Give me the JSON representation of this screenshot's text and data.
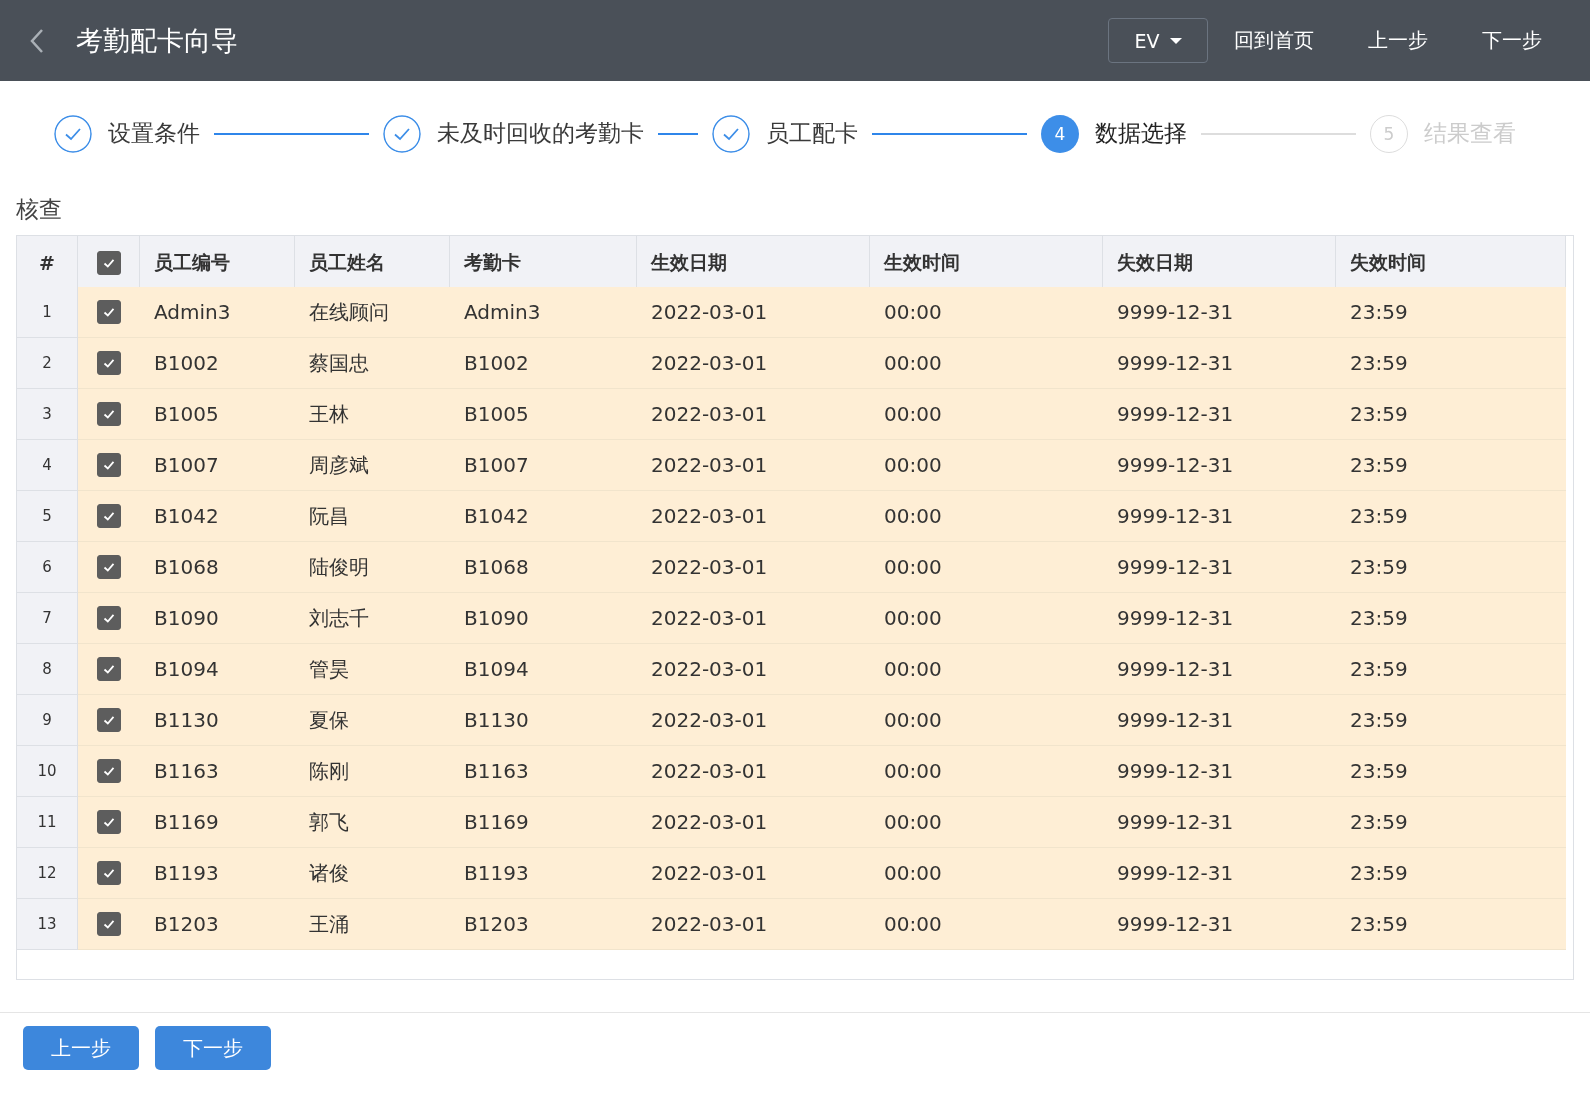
{
  "header": {
    "title": "考勤配卡向导",
    "lang_select": "EV",
    "links": [
      "回到首页",
      "上一步",
      "下一步"
    ]
  },
  "steps": [
    {
      "label": "设置条件",
      "completed": true,
      "current": false
    },
    {
      "label": "未及时回收的考勤卡",
      "completed": true,
      "current": false
    },
    {
      "label": "员工配卡",
      "completed": true,
      "current": false
    },
    {
      "number": "4",
      "label": "数据选择",
      "completed": false,
      "current": true
    },
    {
      "number": "5",
      "label": "结果查看",
      "completed": false,
      "current": false
    }
  ],
  "section_title": "核查",
  "table": {
    "columns": [
      "#",
      "员工编号",
      "员工姓名",
      "考勤卡",
      "生效日期",
      "生效时间",
      "失效日期",
      "失效时间"
    ],
    "all_checked": true,
    "rows": [
      {
        "checked": true,
        "cells": [
          "1",
          "Admin3",
          "在线顾问",
          "Admin3",
          "2022-03-01",
          "00:00",
          "9999-12-31",
          "23:59"
        ]
      },
      {
        "checked": true,
        "cells": [
          "2",
          "B1002",
          "蔡国忠",
          "B1002",
          "2022-03-01",
          "00:00",
          "9999-12-31",
          "23:59"
        ]
      },
      {
        "checked": true,
        "cells": [
          "3",
          "B1005",
          "王林",
          "B1005",
          "2022-03-01",
          "00:00",
          "9999-12-31",
          "23:59"
        ]
      },
      {
        "checked": true,
        "cells": [
          "4",
          "B1007",
          "周彦斌",
          "B1007",
          "2022-03-01",
          "00:00",
          "9999-12-31",
          "23:59"
        ]
      },
      {
        "checked": true,
        "cells": [
          "5",
          "B1042",
          "阮昌",
          "B1042",
          "2022-03-01",
          "00:00",
          "9999-12-31",
          "23:59"
        ]
      },
      {
        "checked": true,
        "cells": [
          "6",
          "B1068",
          "陆俊明",
          "B1068",
          "2022-03-01",
          "00:00",
          "9999-12-31",
          "23:59"
        ]
      },
      {
        "checked": true,
        "cells": [
          "7",
          "B1090",
          "刘志千",
          "B1090",
          "2022-03-01",
          "00:00",
          "9999-12-31",
          "23:59"
        ]
      },
      {
        "checked": true,
        "cells": [
          "8",
          "B1094",
          "管昊",
          "B1094",
          "2022-03-01",
          "00:00",
          "9999-12-31",
          "23:59"
        ]
      },
      {
        "checked": true,
        "cells": [
          "9",
          "B1130",
          "夏保",
          "B1130",
          "2022-03-01",
          "00:00",
          "9999-12-31",
          "23:59"
        ]
      },
      {
        "checked": true,
        "cells": [
          "10",
          "B1163",
          "陈刚",
          "B1163",
          "2022-03-01",
          "00:00",
          "9999-12-31",
          "23:59"
        ]
      },
      {
        "checked": true,
        "cells": [
          "11",
          "B1169",
          "郭飞",
          "B1169",
          "2022-03-01",
          "00:00",
          "9999-12-31",
          "23:59"
        ]
      },
      {
        "checked": true,
        "cells": [
          "12",
          "B1193",
          "诸俊",
          "B1193",
          "2022-03-01",
          "00:00",
          "9999-12-31",
          "23:59"
        ]
      },
      {
        "checked": true,
        "cells": [
          "13",
          "B1203",
          "王涌",
          "B1203",
          "2022-03-01",
          "00:00",
          "9999-12-31",
          "23:59"
        ]
      }
    ]
  },
  "footer_buttons": [
    "上一步",
    "下一步"
  ]
}
